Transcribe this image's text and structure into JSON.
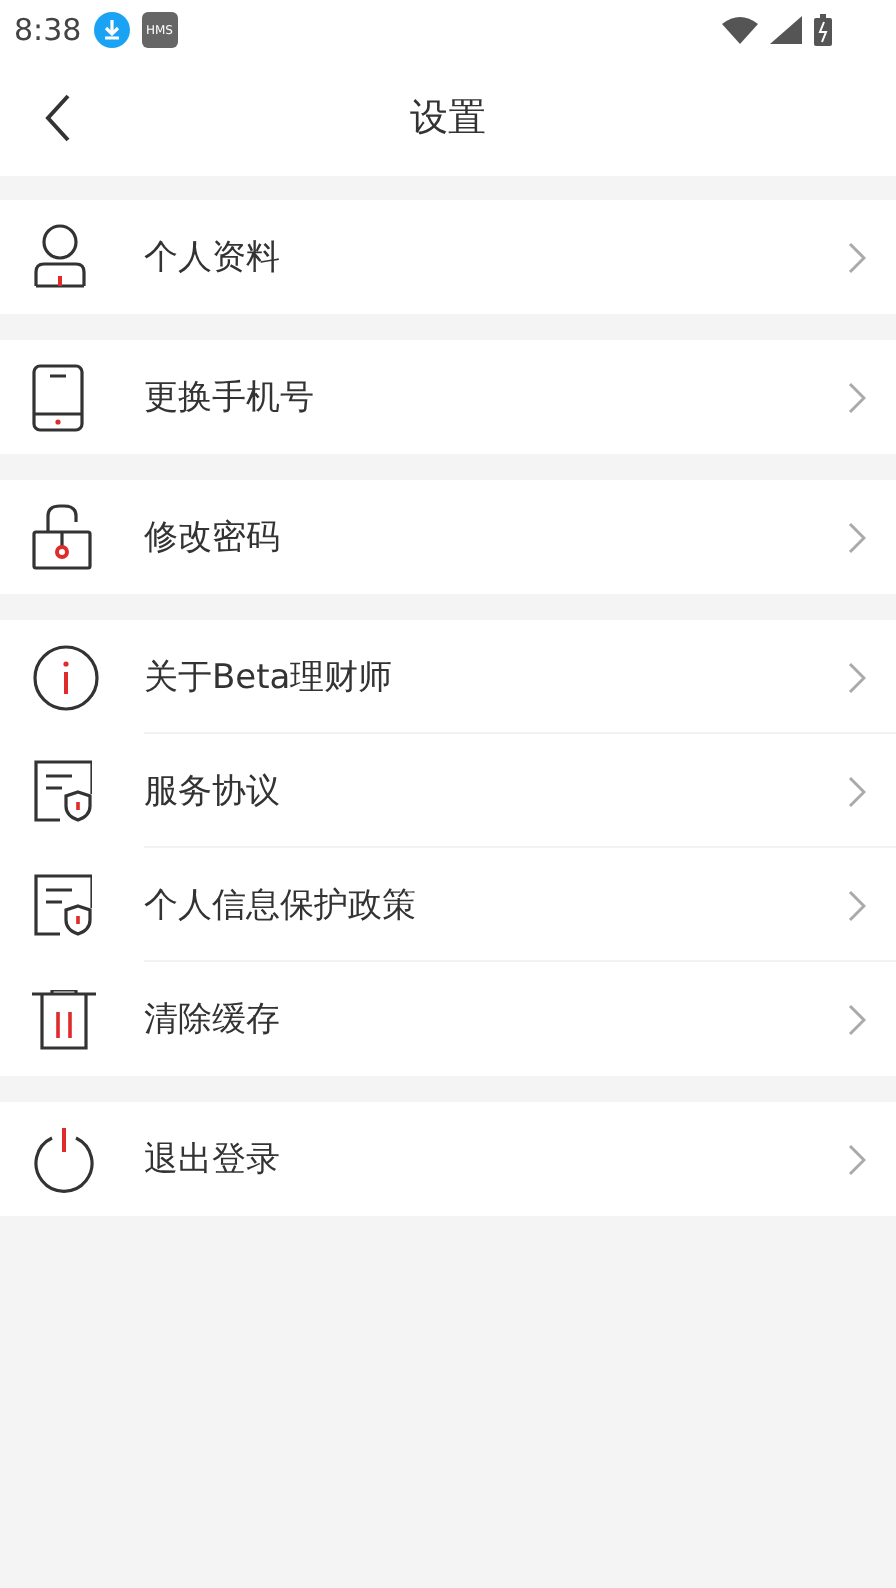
{
  "status_bar": {
    "time": "8:38",
    "badge": "HMS"
  },
  "header": {
    "title": "设置"
  },
  "groups": [
    {
      "items": [
        {
          "kind": "person",
          "label": "个人资料"
        }
      ]
    },
    {
      "items": [
        {
          "kind": "phone",
          "label": "更换手机号"
        }
      ]
    },
    {
      "items": [
        {
          "kind": "lock",
          "label": "修改密码"
        }
      ]
    },
    {
      "items": [
        {
          "kind": "info",
          "label": "关于Beta理财师"
        },
        {
          "kind": "document",
          "label": "服务协议"
        },
        {
          "kind": "document",
          "label": "个人信息保护政策"
        },
        {
          "kind": "trash",
          "label": "清除缓存"
        }
      ]
    },
    {
      "items": [
        {
          "kind": "power",
          "label": "退出登录"
        }
      ]
    }
  ]
}
